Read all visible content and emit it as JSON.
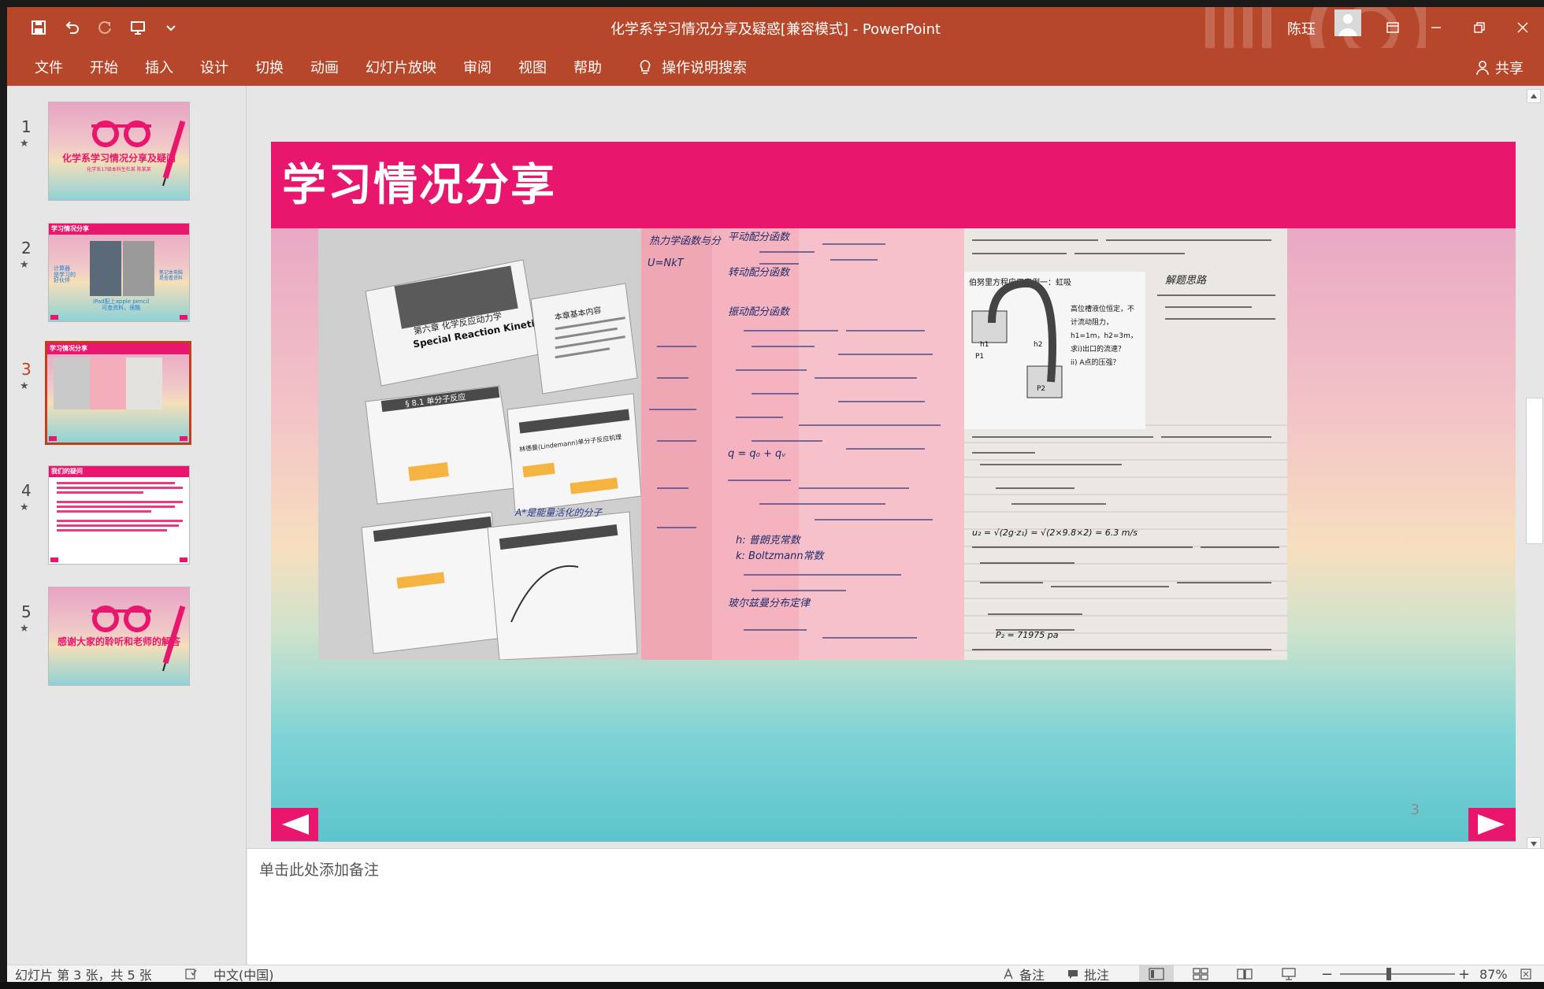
{
  "window": {
    "title": "化学系学习情况分享及疑惑[兼容模式]  -  PowerPoint",
    "user_name": "陈珏"
  },
  "ribbon": {
    "tabs": [
      "文件",
      "开始",
      "插入",
      "设计",
      "切换",
      "动画",
      "幻灯片放映",
      "审阅",
      "视图",
      "帮助"
    ],
    "tell_me": "操作说明搜索",
    "share": "共享"
  },
  "thumbnails": [
    {
      "number": "1",
      "title": "化学系学习情况分享及疑问",
      "subtitle": "化学系17级本科生杜某 陈某某"
    },
    {
      "number": "2",
      "header": "学习情况分享",
      "left_text": "计算器\n是学习的\n好伙伴",
      "right_text": "笔记本电脑\n是查看资料",
      "bottom_text": "iPad配上apple pencil\n可查资料，很酷"
    },
    {
      "number": "3",
      "header": "学习情况分享"
    },
    {
      "number": "4",
      "header": "我们的疑问"
    },
    {
      "number": "5",
      "title": "感谢大家的聆听和老师的解答"
    }
  ],
  "current_slide": {
    "title": "学习情况分享",
    "page_number": "3",
    "photo1": {
      "heading1": "第六章 化学反应动力学",
      "heading2": "Special Reaction Kinetics",
      "section": "本章基本内容",
      "box1": "§ 8.1 单分子反应",
      "box2": "林德曼(Lindemann)单分子反应机理",
      "handwriting": "A*是能量活化的分子"
    },
    "photo2": {
      "handwriting": [
        "热力学函数与分",
        "平动配分函数",
        "U=NkT",
        "转动配分函数",
        "振动配分函数",
        "q = q₀ + qᵥ",
        "h: 普朗克常数",
        "k: Boltzmann常数",
        "玻尔兹曼分布定律"
      ]
    },
    "photo3": {
      "header": "伯努里方程应用实例一：虹吸",
      "lines": [
        "高位槽液位恒定，不",
        "计流动阻力，",
        "h1=1m，h2=3m，",
        "求i)出口的流速？",
        "ii) A点的压强？"
      ],
      "labels": [
        "h1",
        "h2",
        "P1",
        "P2"
      ],
      "side_note": "解题思路",
      "calc": "u₂ = √(2g·z₁) = √(2×9.8×2) = 6.3 m/s",
      "result": "P₂ = 71975 pa"
    }
  },
  "notes": {
    "placeholder": "单击此处添加备注"
  },
  "status": {
    "slide_info": "幻灯片 第 3 张，共 5 张",
    "language": "中文(中国)",
    "notes_label": "备注",
    "comments_label": "批注",
    "zoom": "87%",
    "zoom_level": 0.87
  },
  "colors": {
    "title_bar": "#b7472a",
    "slide_accent": "#e8166c",
    "active_thumb": "#c43e1c"
  }
}
